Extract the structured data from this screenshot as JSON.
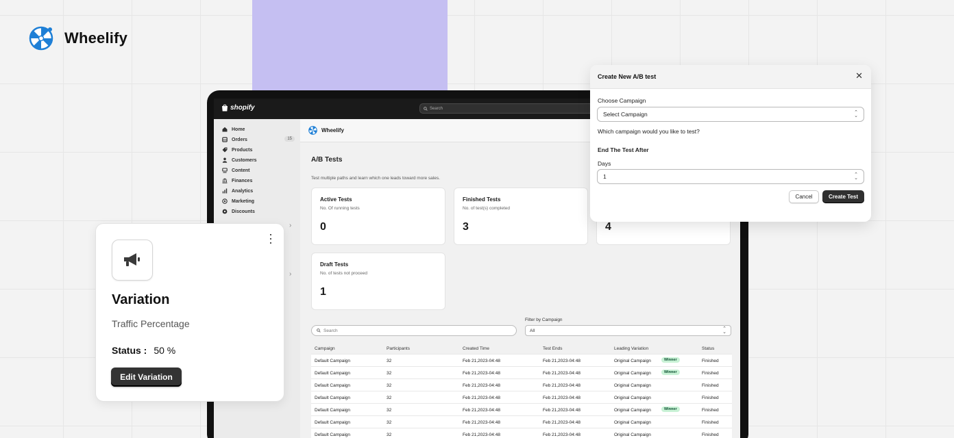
{
  "brand": {
    "name": "Wheelify"
  },
  "colors": {
    "accent": "#c5bff2",
    "dark_button": "#303030",
    "winner_bg": "#c9f2d6",
    "wheel_blue": "#1e7fd6"
  },
  "shopify": {
    "logo": "shopify",
    "search_placeholder": "Search",
    "nav": [
      {
        "label": "Home",
        "icon": "home-icon"
      },
      {
        "label": "Orders",
        "icon": "orders-icon",
        "badge": "15"
      },
      {
        "label": "Products",
        "icon": "tag-icon"
      },
      {
        "label": "Customers",
        "icon": "person-icon"
      },
      {
        "label": "Content",
        "icon": "content-icon"
      },
      {
        "label": "Finances",
        "icon": "bank-icon"
      },
      {
        "label": "Analytics",
        "icon": "chart-icon"
      },
      {
        "label": "Marketing",
        "icon": "target-icon"
      },
      {
        "label": "Discounts",
        "icon": "gear-icon"
      }
    ],
    "chevron": "›"
  },
  "app": {
    "name": "Wheelify",
    "title": "A/B Tests",
    "subtitle": "Test multiple paths and learn which one leads toward more sales.",
    "stats": [
      {
        "title": "Active Tests",
        "sub": "No. Of running tests",
        "value": "0"
      },
      {
        "title": "Finished Tests",
        "sub": "No. of test(s) completed",
        "value": "3"
      },
      {
        "title": "",
        "sub": "",
        "value": "4"
      },
      {
        "title": "Draft Tests",
        "sub": "No. of tests not proceed",
        "value": "1"
      }
    ],
    "search_placeholder": "Search",
    "filter_label": "Filter by Campaign",
    "filter_value": "All",
    "table": {
      "headers": [
        "Campaign",
        "Participants",
        "Created Time",
        "Test Ends",
        "Leading Variation",
        "Status"
      ],
      "rows": [
        {
          "campaign": "Default Campaign",
          "participants": "32",
          "created": "Feb 21,2023-04:48",
          "ends": "Feb 21,2023-04:48",
          "leading": "Original Campaign",
          "winner": "Winner",
          "status": "Finished"
        },
        {
          "campaign": "Default Campaign",
          "participants": "32",
          "created": "Feb 21,2023-04:48",
          "ends": "Feb 21,2023-04:48",
          "leading": "Original Campaign",
          "winner": "Winner",
          "status": "Finished"
        },
        {
          "campaign": "Default Campaign",
          "participants": "32",
          "created": "Feb 21,2023-04:48",
          "ends": "Feb 21,2023-04:48",
          "leading": "Original Campaign",
          "winner": "",
          "status": "Finished"
        },
        {
          "campaign": "Default Campaign",
          "participants": "32",
          "created": "Feb 21,2023-04:48",
          "ends": "Feb 21,2023-04:48",
          "leading": "Original Campaign",
          "winner": "",
          "status": "Finished"
        },
        {
          "campaign": "Default Campaign",
          "participants": "32",
          "created": "Feb 21,2023-04:48",
          "ends": "Feb 21,2023-04:48",
          "leading": "Original Campaign",
          "winner": "Winner",
          "status": "Finished"
        },
        {
          "campaign": "Default Campaign",
          "participants": "32",
          "created": "Feb 21,2023-04:48",
          "ends": "Feb 21,2023-04:48",
          "leading": "Original Campaign",
          "winner": "",
          "status": "Finished"
        },
        {
          "campaign": "Default Campaign",
          "participants": "32",
          "created": "Feb 21,2023-04:48",
          "ends": "Feb 21,2023-04:48",
          "leading": "Original Campaign",
          "winner": "",
          "status": "Finished"
        }
      ]
    }
  },
  "variation_card": {
    "title": "Variation",
    "subtitle": "Traffic Percentage",
    "status_label": "Status :",
    "status_value": "50 %",
    "button": "Edit Variation",
    "icon": "megaphone-icon"
  },
  "modal": {
    "title": "Create New A/B test",
    "close": "✕",
    "campaign_label": "Choose Campaign",
    "campaign_value": "Select Campaign",
    "campaign_help": "Which campaign would you like to test?",
    "end_label": "End The Test After",
    "days_label": "Days",
    "days_value": "1",
    "cancel": "Cancel",
    "create": "Create Test"
  }
}
